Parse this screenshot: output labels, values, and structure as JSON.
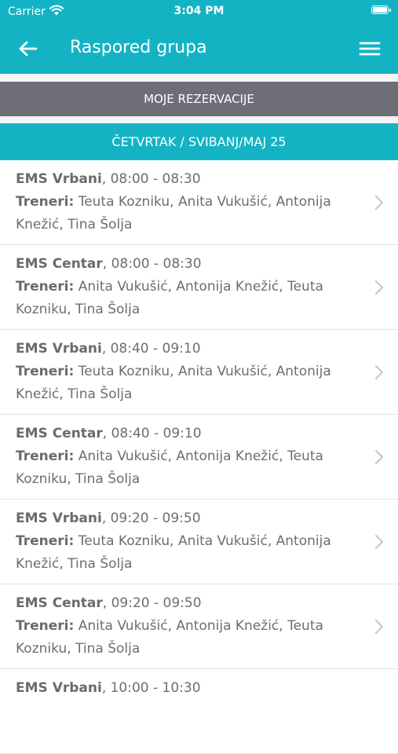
{
  "status": {
    "carrier": "Carrier",
    "time": "3:04 PM"
  },
  "nav": {
    "title": "Raspored grupa"
  },
  "my_reservations_label": "MOJE REZERVACIJE",
  "date_header": "ČETVRTAK / SVIBANJ/MAJ 25",
  "trainers_label": "Treneri:",
  "sessions": [
    {
      "location": "EMS Vrbani",
      "time": ", 08:00 - 08:30",
      "trainers": " Teuta Kozniku, Anita Vukušić, Antonija Knežić, Tina Šolja"
    },
    {
      "location": "EMS Centar",
      "time": ", 08:00 - 08:30",
      "trainers": " Anita Vukušić, Antonija Knežić, Teuta Kozniku, Tina Šolja"
    },
    {
      "location": "EMS Vrbani",
      "time": ", 08:40 - 09:10",
      "trainers": " Teuta Kozniku, Anita Vukušić, Antonija Knežić, Tina Šolja"
    },
    {
      "location": "EMS Centar",
      "time": ", 08:40 - 09:10",
      "trainers": " Anita Vukušić, Antonija Knežić, Teuta Kozniku, Tina Šolja"
    },
    {
      "location": "EMS Vrbani",
      "time": ", 09:20 - 09:50",
      "trainers": " Teuta Kozniku, Anita Vukušić, Antonija Knežić, Tina Šolja"
    },
    {
      "location": "EMS Centar",
      "time": ", 09:20 - 09:50",
      "trainers": " Anita Vukušić, Antonija Knežić, Teuta Kozniku, Tina Šolja"
    },
    {
      "location": "EMS Vrbani",
      "time": ", 10:00 - 10:30",
      "trainers": ""
    }
  ],
  "colors": {
    "accent": "#13b3c4",
    "button_gray": "#6d6e77",
    "text_gray": "#6d6d72"
  },
  "icons": {
    "back": "arrow-left-icon",
    "menu": "hamburger-menu-icon",
    "row": "chevron-right-icon"
  }
}
